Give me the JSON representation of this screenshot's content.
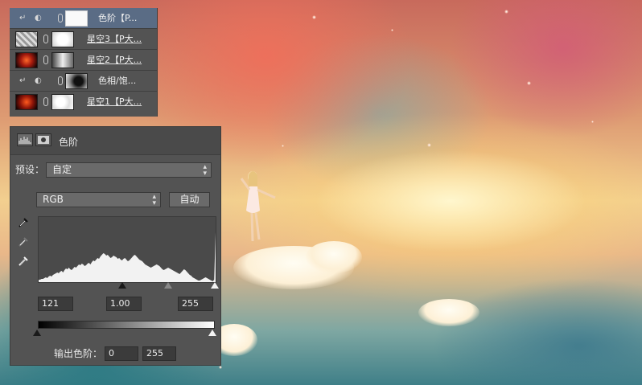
{
  "layers": [
    {
      "name": "色阶【P...",
      "type": "adjustment",
      "selected": true,
      "mask": "white"
    },
    {
      "name": "星空3【P大...",
      "type": "image",
      "selected": false,
      "mask": "white-soft"
    },
    {
      "name": "星空2【P大...",
      "type": "image",
      "selected": false,
      "mask": "gray-gradient"
    },
    {
      "name": "色相/饱...",
      "type": "adjustment",
      "selected": false,
      "mask": "black-soft"
    },
    {
      "name": "星空1【P大...",
      "type": "image",
      "selected": false,
      "mask": "white-spots"
    }
  ],
  "properties": {
    "title": "色阶",
    "preset_label": "预设：",
    "preset_value": "自定",
    "channel_value": "RGB",
    "auto_label": "自动",
    "input_black": "121",
    "input_gamma": "1.00",
    "input_white": "255",
    "output_label": "输出色阶：",
    "output_black": "0",
    "output_white": "255",
    "histogram": [
      3,
      3,
      4,
      4,
      5,
      6,
      5,
      7,
      8,
      7,
      9,
      10,
      11,
      12,
      11,
      13,
      14,
      12,
      15,
      17,
      16,
      18,
      16,
      15,
      17,
      19,
      18,
      20,
      22,
      21,
      23,
      22,
      20,
      21,
      23,
      24,
      22,
      25,
      27,
      26,
      28,
      30,
      29,
      32,
      34,
      36,
      35,
      33,
      34,
      32,
      30,
      31,
      33,
      32,
      31,
      29,
      30,
      28,
      27,
      29,
      30,
      28,
      26,
      27,
      29,
      31,
      33,
      34,
      32,
      30,
      28,
      27,
      26,
      24,
      22,
      21,
      20,
      19,
      18,
      19,
      20,
      21,
      22,
      21,
      20,
      18,
      16,
      15,
      16,
      17,
      18,
      17,
      16,
      15,
      14,
      13,
      12,
      11,
      10,
      12,
      14,
      16,
      15,
      13,
      11,
      9,
      8,
      6,
      5,
      4,
      3,
      2,
      2,
      3,
      4,
      5,
      6,
      5,
      4,
      3,
      2,
      1,
      3,
      62
    ],
    "colors": {
      "panel": "#535353",
      "selected_layer": "#5a6c85"
    }
  }
}
